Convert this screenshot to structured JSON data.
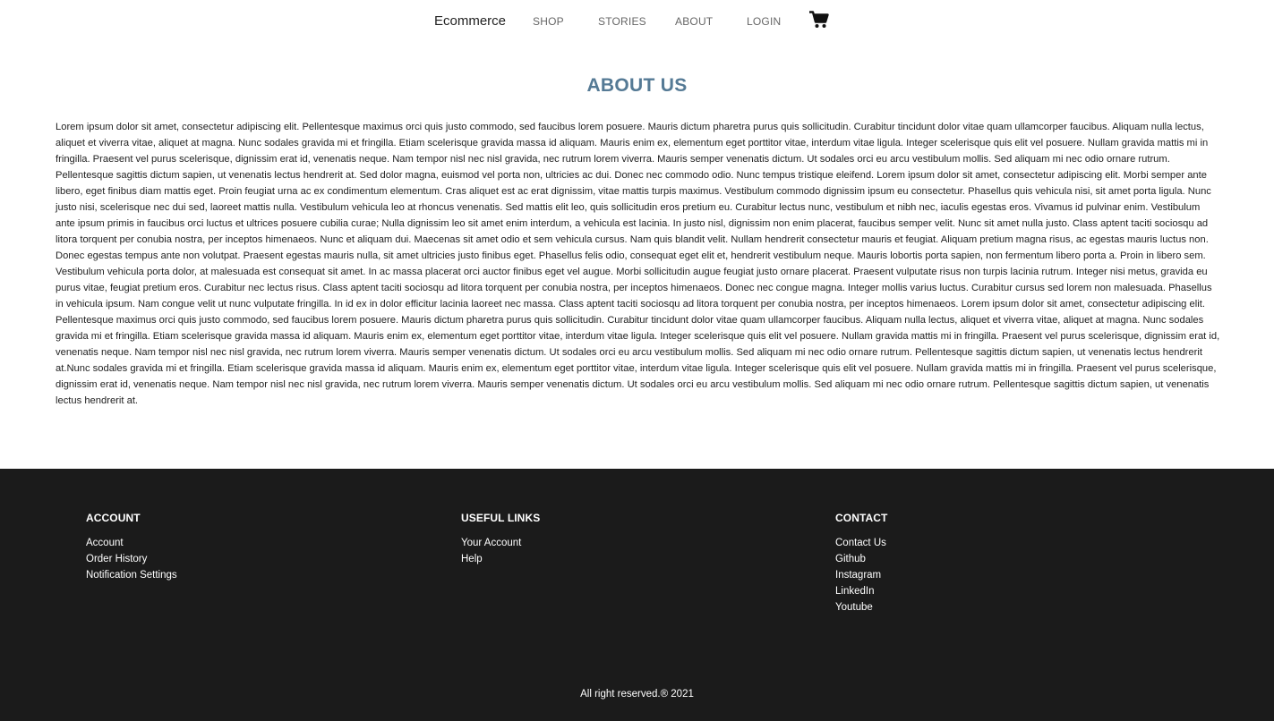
{
  "navbar": {
    "brand": "Ecommerce",
    "links": [
      "SHOP",
      "STORIES",
      "ABOUT",
      "LOGIN"
    ],
    "cart_icon": "shopping-cart-icon"
  },
  "about": {
    "title": "ABOUT US",
    "body": "Lorem ipsum dolor sit amet, consectetur adipiscing elit. Pellentesque maximus orci quis justo commodo, sed faucibus lorem posuere. Mauris dictum pharetra purus quis sollicitudin. Curabitur tincidunt dolor vitae quam ullamcorper faucibus. Aliquam nulla lectus, aliquet et viverra vitae, aliquet at magna. Nunc sodales gravida mi et fringilla. Etiam scelerisque gravida massa id aliquam. Mauris enim ex, elementum eget porttitor vitae, interdum vitae ligula. Integer scelerisque quis elit vel posuere. Nullam gravida mattis mi in fringilla. Praesent vel purus scelerisque, dignissim erat id, venenatis neque. Nam tempor nisl nec nisl gravida, nec rutrum lorem viverra. Mauris semper venenatis dictum. Ut sodales orci eu arcu vestibulum mollis. Sed aliquam mi nec odio ornare rutrum. Pellentesque sagittis dictum sapien, ut venenatis lectus hendrerit at. Sed dolor magna, euismod vel porta non, ultricies ac dui. Donec nec commodo odio. Nunc tempus tristique eleifend. Lorem ipsum dolor sit amet, consectetur adipiscing elit. Morbi semper ante libero, eget finibus diam mattis eget. Proin feugiat urna ac ex condimentum elementum. Cras aliquet est ac erat dignissim, vitae mattis turpis maximus. Vestibulum commodo dignissim ipsum eu consectetur. Phasellus quis vehicula nisi, sit amet porta ligula. Nunc justo nisi, scelerisque nec dui sed, laoreet mattis nulla. Vestibulum vehicula leo at rhoncus venenatis. Sed mattis elit leo, quis sollicitudin eros pretium eu. Curabitur lectus nunc, vestibulum et nibh nec, iaculis egestas eros. Vivamus id pulvinar enim. Vestibulum ante ipsum primis in faucibus orci luctus et ultrices posuere cubilia curae; Nulla dignissim leo sit amet enim interdum, a vehicula est lacinia. In justo nisl, dignissim non enim placerat, faucibus semper velit. Nunc sit amet nulla justo. Class aptent taciti sociosqu ad litora torquent per conubia nostra, per inceptos himenaeos. Nunc et aliquam dui. Maecenas sit amet odio et sem vehicula cursus. Nam quis blandit velit. Nullam hendrerit consectetur mauris et feugiat. Aliquam pretium magna risus, ac egestas mauris luctus non. Donec egestas tempus ante non volutpat. Praesent egestas mauris nulla, sit amet ultricies justo finibus eget. Phasellus felis odio, consequat eget elit et, hendrerit vestibulum neque. Mauris lobortis porta sapien, non fermentum libero porta a. Proin in libero sem. Vestibulum vehicula porta dolor, at malesuada est consequat sit amet. In ac massa placerat orci auctor finibus eget vel augue. Morbi sollicitudin augue feugiat justo ornare placerat. Praesent vulputate risus non turpis lacinia rutrum. Integer nisi metus, gravida eu purus vitae, feugiat pretium eros. Curabitur nec lectus risus. Class aptent taciti sociosqu ad litora torquent per conubia nostra, per inceptos himenaeos. Donec nec congue magna. Integer mollis varius luctus. Curabitur cursus sed lorem non malesuada. Phasellus in vehicula ipsum. Nam congue velit ut nunc vulputate fringilla. In id ex in dolor efficitur lacinia laoreet nec massa. Class aptent taciti sociosqu ad litora torquent per conubia nostra, per inceptos himenaeos. Lorem ipsum dolor sit amet, consectetur adipiscing elit. Pellentesque maximus orci quis justo commodo, sed faucibus lorem posuere. Mauris dictum pharetra purus quis sollicitudin. Curabitur tincidunt dolor vitae quam ullamcorper faucibus. Aliquam nulla lectus, aliquet et viverra vitae, aliquet at magna. Nunc sodales gravida mi et fringilla. Etiam scelerisque gravida massa id aliquam. Mauris enim ex, elementum eget porttitor vitae, interdum vitae ligula. Integer scelerisque quis elit vel posuere. Nullam gravida mattis mi in fringilla. Praesent vel purus scelerisque, dignissim erat id, venenatis neque. Nam tempor nisl nec nisl gravida, nec rutrum lorem viverra. Mauris semper venenatis dictum. Ut sodales orci eu arcu vestibulum mollis. Sed aliquam mi nec odio ornare rutrum. Pellentesque sagittis dictum sapien, ut venenatis lectus hendrerit at.Nunc sodales gravida mi et fringilla. Etiam scelerisque gravida massa id aliquam. Mauris enim ex, elementum eget porttitor vitae, interdum vitae ligula. Integer scelerisque quis elit vel posuere. Nullam gravida mattis mi in fringilla. Praesent vel purus scelerisque, dignissim erat id, venenatis neque. Nam tempor nisl nec nisl gravida, nec rutrum lorem viverra. Mauris semper venenatis dictum. Ut sodales orci eu arcu vestibulum mollis. Sed aliquam mi nec odio ornare rutrum. Pellentesque sagittis dictum sapien, ut venenatis lectus hendrerit at."
  },
  "footer": {
    "account": {
      "heading": "ACCOUNT",
      "links": [
        "Account",
        "Order History",
        "Notification Settings"
      ]
    },
    "useful_links": {
      "heading": "USEFUL LINKS",
      "links": [
        "Your Account",
        "Help"
      ]
    },
    "contact": {
      "heading": "CONTACT",
      "links": [
        "Contact Us",
        "Github",
        "Instagram",
        "LinkedIn",
        "Youtube"
      ]
    },
    "copyright": "All right reserved.® 2021"
  },
  "colors": {
    "title_accent": "#557a95",
    "footer_bg": "#1b1b1b",
    "nav_link": "#666666"
  }
}
